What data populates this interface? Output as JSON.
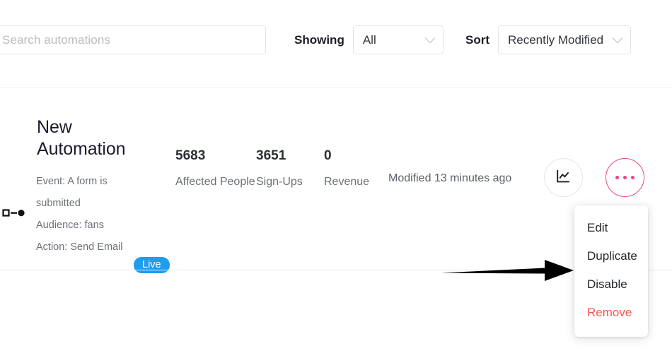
{
  "toolbar": {
    "search": {
      "placeholder": "Search automations",
      "value": ""
    },
    "showing": {
      "label": "Showing",
      "selected": "All",
      "chevron_icon": "chevron-down-icon"
    },
    "sort": {
      "label": "Sort",
      "selected": "Recently Modified",
      "chevron_icon": "chevron-down-icon"
    }
  },
  "automation": {
    "flow_icon": "workflow-node-icon",
    "title": "New Automation",
    "status_badge": "Live",
    "details": {
      "event_label": "Event:",
      "event_value": "A form is submitted",
      "audience_label": "Audience:",
      "audience_value": "fans",
      "action_label": "Action:",
      "action_value": "Send Email"
    },
    "stats": [
      {
        "value": "5683",
        "label": "Affected People"
      },
      {
        "value": "3651",
        "label": "Sign-Ups"
      },
      {
        "value": "0",
        "label": "Revenue"
      }
    ],
    "modified": "Modified 13 minutes ago",
    "report_button_icon": "line-chart-icon",
    "more_button_icon": "ellipsis-icon"
  },
  "menu": {
    "items": [
      {
        "label": "Edit",
        "danger": false
      },
      {
        "label": "Duplicate",
        "danger": false
      },
      {
        "label": "Disable",
        "danger": false
      },
      {
        "label": "Remove",
        "danger": true
      }
    ]
  },
  "annotation": {
    "arrow_icon": "arrow-right-annotation"
  },
  "colors": {
    "badge_blue": "#1e9cf0",
    "accent_pink": "#e9448d",
    "danger_red": "#f5574f",
    "border_grey": "#e2e4e6",
    "text_dark": "#1b1b2b",
    "text_muted": "#6b7078"
  }
}
